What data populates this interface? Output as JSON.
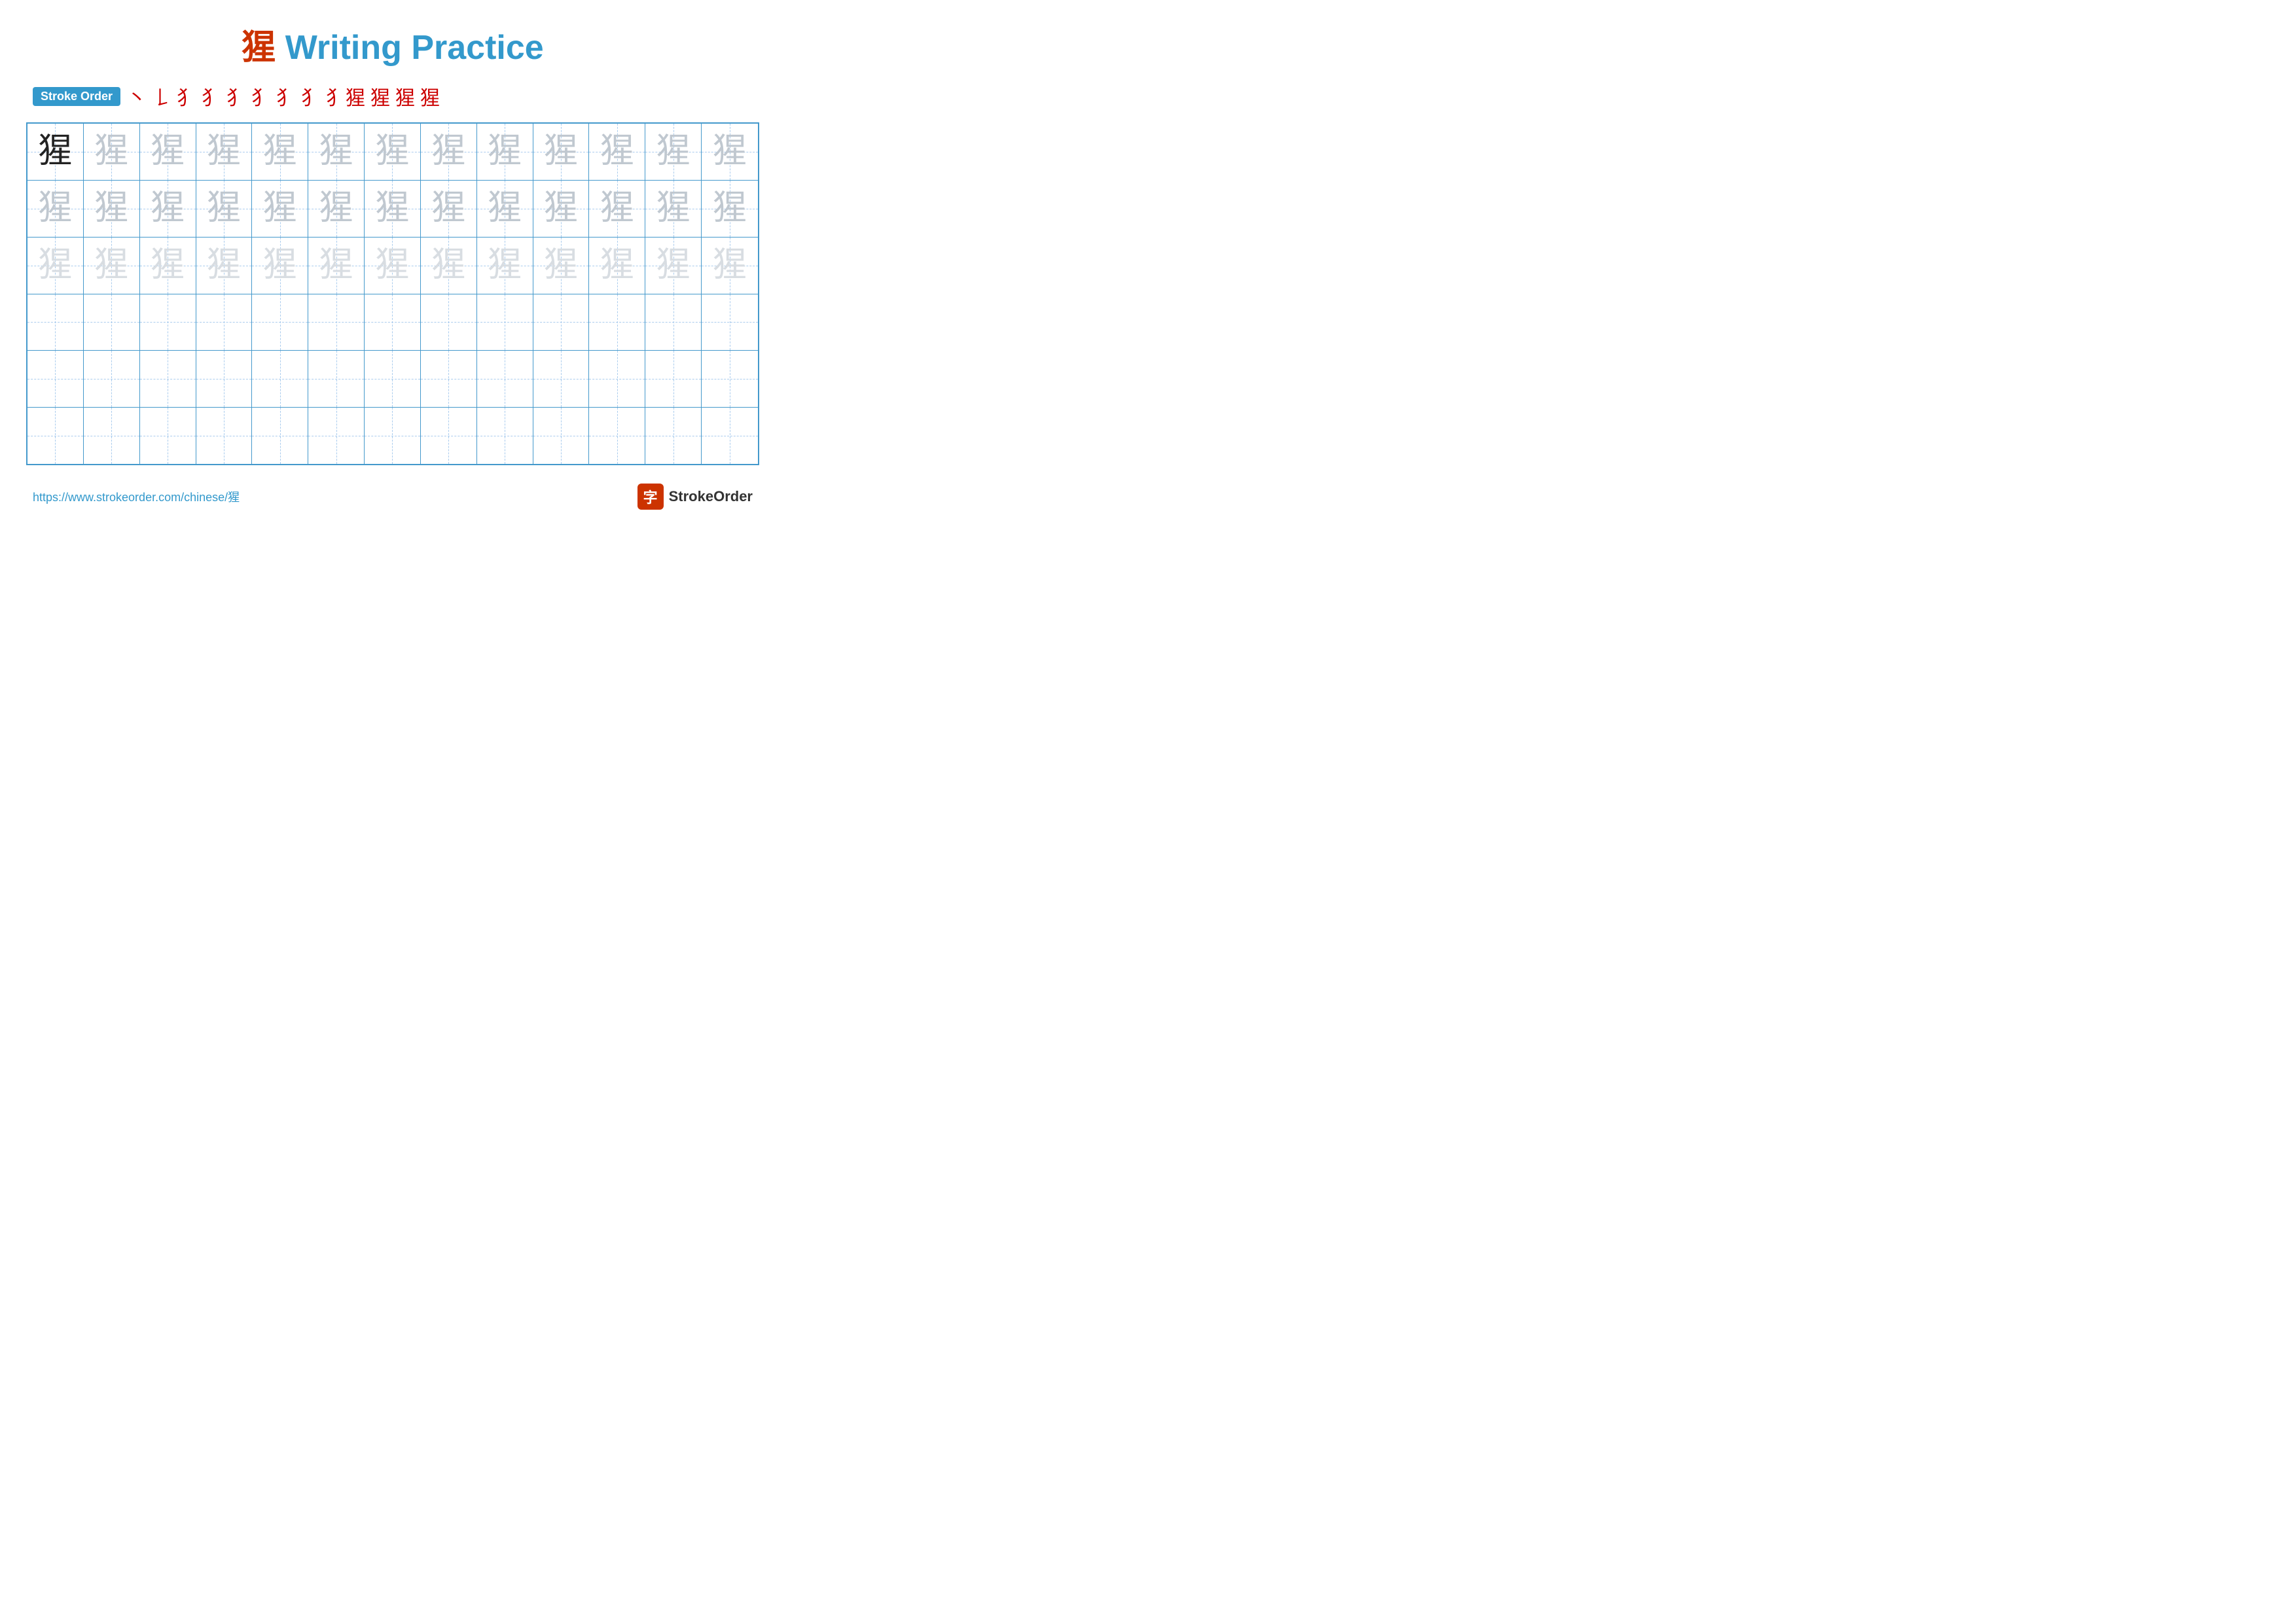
{
  "title": {
    "prefix_char": "猩",
    "text": " Writing Practice"
  },
  "stroke_order": {
    "badge_label": "Stroke Order",
    "strokes": [
      "丶",
      "𠄌",
      "𠄎",
      "𠄑",
      "犭",
      "犭",
      "犭",
      "犭",
      "犭猩",
      "猩",
      "猩",
      "猩"
    ]
  },
  "character": "猩",
  "rows": [
    {
      "type": "dark_then_medium",
      "dark_count": 1,
      "total": 13
    },
    {
      "type": "medium",
      "total": 13
    },
    {
      "type": "light",
      "total": 13
    },
    {
      "type": "empty",
      "total": 13
    },
    {
      "type": "empty",
      "total": 13
    },
    {
      "type": "empty",
      "total": 13
    }
  ],
  "footer": {
    "url": "https://www.strokeorder.com/chinese/猩",
    "brand": "StrokeOrder"
  }
}
